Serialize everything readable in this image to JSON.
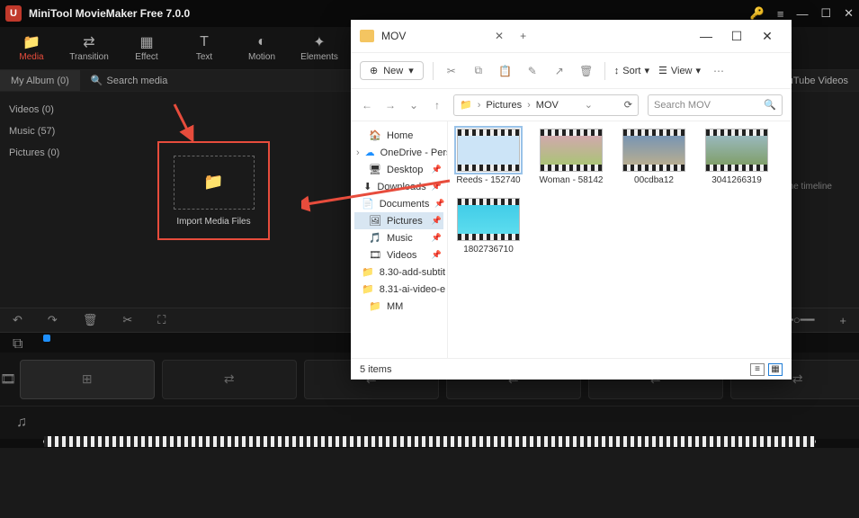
{
  "app": {
    "title": "MiniTool MovieMaker Free 7.0.0"
  },
  "topbar": [
    {
      "icon": "📁",
      "label": "Media",
      "active": true
    },
    {
      "icon": "⇄",
      "label": "Transition"
    },
    {
      "icon": "▦",
      "label": "Effect"
    },
    {
      "icon": "T",
      "label": "Text"
    },
    {
      "icon": "◐",
      "label": "Motion"
    },
    {
      "icon": "✦",
      "label": "Elements"
    }
  ],
  "secbar": {
    "album": "My Album (0)",
    "search": "Search media",
    "download": "Download YouTube Videos"
  },
  "sidebar": [
    {
      "label": "Videos (0)"
    },
    {
      "label": "Music (57)"
    },
    {
      "label": "Pictures (0)"
    }
  ],
  "import_label": "Import Media Files",
  "preview_hint": "n the timeline",
  "dialog": {
    "tab": "MOV",
    "new_label": "New",
    "sort_label": "Sort",
    "view_label": "View",
    "path": {
      "root_icon": "📁",
      "parts": [
        "Pictures",
        "MOV"
      ]
    },
    "search_placeholder": "Search MOV",
    "sidebar": [
      {
        "icon": "🏠",
        "label": "Home"
      },
      {
        "icon": "☁",
        "label": "OneDrive - Pers",
        "expand": true,
        "cloud": true
      },
      {
        "icon": "🖥",
        "label": "Desktop",
        "pin": true
      },
      {
        "icon": "⬇",
        "label": "Downloads",
        "pin": true
      },
      {
        "icon": "📄",
        "label": "Documents",
        "pin": true
      },
      {
        "icon": "🖼",
        "label": "Pictures",
        "pin": true,
        "selected": true
      },
      {
        "icon": "🎵",
        "label": "Music",
        "pin": true
      },
      {
        "icon": "🎞",
        "label": "Videos",
        "pin": true
      },
      {
        "icon": "📁",
        "label": "8.30-add-subtit"
      },
      {
        "icon": "📁",
        "label": "8.31-ai-video-e"
      },
      {
        "icon": "📁",
        "label": "MM"
      }
    ],
    "files": [
      {
        "name": "Reeds - 152740",
        "selected": true,
        "cls": ""
      },
      {
        "name": "Woman - 58142",
        "cls": "t2"
      },
      {
        "name": "00cdba12",
        "cls": "t3"
      },
      {
        "name": "3041266319",
        "cls": "t4"
      },
      {
        "name": "1802736710",
        "cls": "t5"
      }
    ],
    "status": "5 items"
  }
}
